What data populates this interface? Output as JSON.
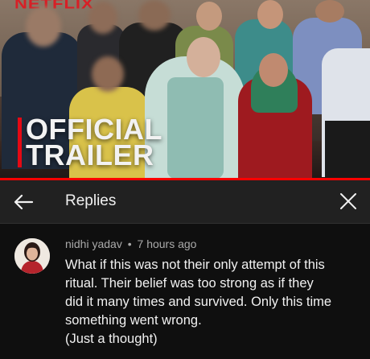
{
  "video": {
    "logo_text": "NETFLIX",
    "overlay_line1": "OFFICIAL",
    "overlay_line2": "TRAILER",
    "progress": 1.0,
    "colors": {
      "accent": "#e50914",
      "progress": "#ff0000"
    }
  },
  "replies_panel": {
    "back_icon": "arrow-left-icon",
    "title": "Replies",
    "close_icon": "close-x-icon"
  },
  "comment": {
    "author": "nidhi yadav",
    "separator": "•",
    "time": "7 hours ago",
    "lines": [
      "What if this was not their only attempt of this",
      "ritual. Their belief was too strong as if they",
      "did it many times and survived. Only this time",
      "something went wrong.",
      "(Just a thought)"
    ]
  }
}
